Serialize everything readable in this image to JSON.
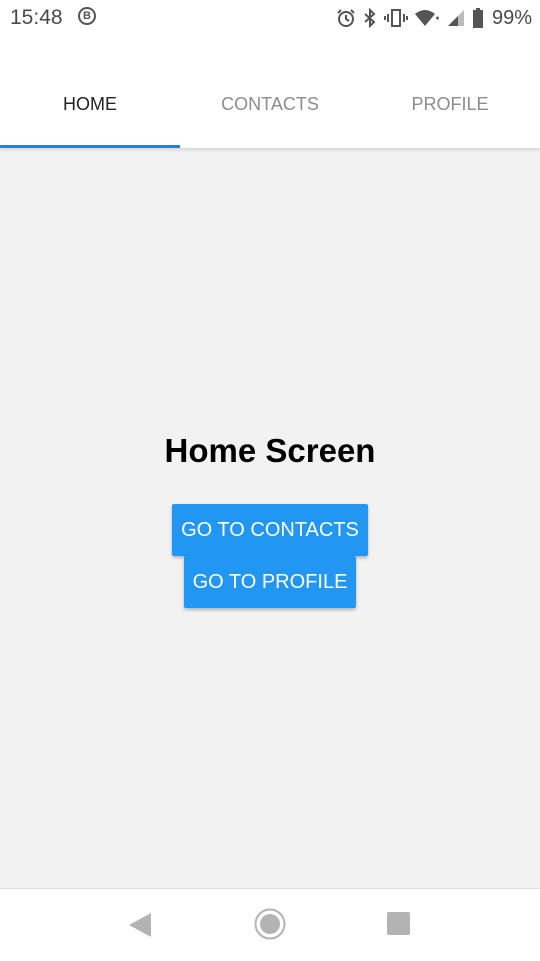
{
  "status_bar": {
    "time": "15:48",
    "notification_badge": "B",
    "battery_percent": "99%",
    "icons": [
      "alarm-icon",
      "bluetooth-icon",
      "vibrate-icon",
      "wifi-icon",
      "cell-signal-icon",
      "battery-icon"
    ]
  },
  "tabs": [
    {
      "label": "HOME",
      "active": true
    },
    {
      "label": "CONTACTS",
      "active": false
    },
    {
      "label": "PROFILE",
      "active": false
    }
  ],
  "main": {
    "title": "Home Screen",
    "buttons": {
      "contacts": "GO TO CONTACTS",
      "profile": "GO TO PROFILE"
    }
  },
  "nav_bar": {
    "icons": [
      "back-icon",
      "home-icon",
      "recent-apps-icon"
    ]
  },
  "colors": {
    "accent": "#2196f3",
    "tab_indicator": "#2b7de0",
    "background": "#f2f2f2"
  }
}
